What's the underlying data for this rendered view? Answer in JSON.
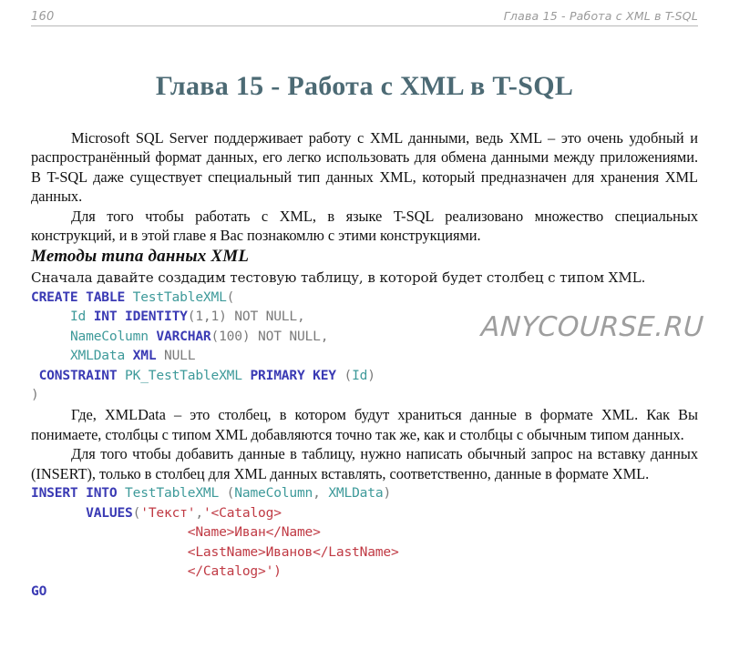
{
  "header": {
    "page_number": "160",
    "chapter_ref": "Глава 15 - Работа с XML в T-SQL"
  },
  "title": "Глава 15 - Работа с XML в T-SQL",
  "paragraphs": {
    "p1": "Microsoft SQL Server поддерживает работу с XML данными, ведь XML – это очень удобный и распространённый формат данных, его легко использовать для обмена данными между приложениями. В T-SQL даже существует специальный тип данных XML, который предназначен для хранения XML данных.",
    "p2": "Для того чтобы работать с XML, в языке T-SQL реализовано множество специальных конструкций, и в этой главе я Вас познакомлю с этими конструкциями.",
    "p3": "Где, XMLData – это столбец, в котором будут храниться данные в формате XML. Как Вы понимаете, столбцы с типом XML добавляются точно так же, как и столбцы с обычным типом данных.",
    "p4": "Для того чтобы добавить данные в таблицу, нужно написать обычный запрос на вставку данных (INSERT), только в столбец для XML данных вставлять, соответственно, данные в формате XML."
  },
  "section": {
    "heading": "Методы типа данных XML",
    "lead": "Сначала давайте создадим тестовую таблицу, в которой будет столбец с типом XML."
  },
  "code_create": {
    "lines": [
      [
        {
          "t": "CREATE TABLE ",
          "c": "kw"
        },
        {
          "t": "TestTableXML",
          "c": "id"
        },
        {
          "t": "(",
          "c": "pl"
        }
      ],
      [
        {
          "t": "     ",
          "c": "pl"
        },
        {
          "t": "Id ",
          "c": "id"
        },
        {
          "t": "INT IDENTITY",
          "c": "kw"
        },
        {
          "t": "(1,1) ",
          "c": "pl"
        },
        {
          "t": "NOT NULL,",
          "c": "pl"
        }
      ],
      [
        {
          "t": "     ",
          "c": "pl"
        },
        {
          "t": "NameColumn ",
          "c": "id"
        },
        {
          "t": "VARCHAR",
          "c": "kw"
        },
        {
          "t": "(100) ",
          "c": "pl"
        },
        {
          "t": "NOT NULL,",
          "c": "pl"
        }
      ],
      [
        {
          "t": "     ",
          "c": "pl"
        },
        {
          "t": "XMLData ",
          "c": "id"
        },
        {
          "t": "XML ",
          "c": "kw"
        },
        {
          "t": "NULL",
          "c": "pl"
        }
      ],
      [
        {
          "t": " ",
          "c": "pl"
        },
        {
          "t": "CONSTRAINT ",
          "c": "kw"
        },
        {
          "t": "PK_TestTableXML ",
          "c": "id"
        },
        {
          "t": "PRIMARY KEY ",
          "c": "kw"
        },
        {
          "t": "(",
          "c": "pl"
        },
        {
          "t": "Id",
          "c": "id"
        },
        {
          "t": ")",
          "c": "pl"
        }
      ],
      [
        {
          "t": ")",
          "c": "pl"
        }
      ]
    ],
    "raw": "CREATE TABLE TestTableXML(\n     Id INT IDENTITY(1,1) NOT NULL,\n     NameColumn VARCHAR(100) NOT NULL,\n     XMLData XML NULL\n CONSTRAINT PK_TestTableXML PRIMARY KEY (Id)\n)"
  },
  "code_insert": {
    "lines": [
      [
        {
          "t": "INSERT INTO ",
          "c": "kw"
        },
        {
          "t": "TestTableXML ",
          "c": "id"
        },
        {
          "t": "(",
          "c": "pl"
        },
        {
          "t": "NameColumn",
          "c": "id"
        },
        {
          "t": ", ",
          "c": "pl"
        },
        {
          "t": "XMLData",
          "c": "id"
        },
        {
          "t": ")",
          "c": "pl"
        }
      ],
      [
        {
          "t": "       ",
          "c": "pl"
        },
        {
          "t": "VALUES",
          "c": "kw"
        },
        {
          "t": "(",
          "c": "pl"
        },
        {
          "t": "'Текст'",
          "c": "str"
        },
        {
          "t": ",",
          "c": "pl"
        },
        {
          "t": "'<Catalog>",
          "c": "str"
        }
      ],
      [
        {
          "t": "                    ",
          "c": "pl"
        },
        {
          "t": "<Name>Иван</Name>",
          "c": "str"
        }
      ],
      [
        {
          "t": "                    ",
          "c": "pl"
        },
        {
          "t": "<LastName>Иванов</LastName>",
          "c": "str"
        }
      ],
      [
        {
          "t": "                    ",
          "c": "pl"
        },
        {
          "t": "</Catalog>')",
          "c": "str"
        }
      ]
    ],
    "raw": "INSERT INTO TestTableXML (NameColumn, XMLData)\n       VALUES('Текст','<Catalog>\n                    <Name>Иван</Name>\n                    <LastName>Иванов</LastName>\n                    </Catalog>')"
  },
  "code_go": {
    "lines": [
      [
        {
          "t": "GO",
          "c": "kw"
        }
      ]
    ],
    "raw": "GO"
  },
  "watermark": "ANYCOURSE.RU",
  "colors": {
    "title": "#4c6a74",
    "keyword": "#3a3ab4",
    "identifier": "#3e9a9a",
    "string": "#c03a44",
    "plain": "#7b7b7b",
    "header_text": "#9a9a9a",
    "watermark": "#9e9e9e"
  }
}
